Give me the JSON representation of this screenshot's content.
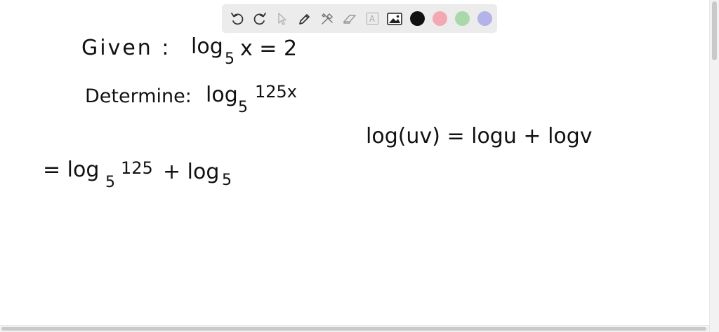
{
  "toolbar": {
    "tools": [
      {
        "name": "undo-icon"
      },
      {
        "name": "redo-icon"
      },
      {
        "name": "select-arrow-icon"
      },
      {
        "name": "pen-icon"
      },
      {
        "name": "tools-icon"
      },
      {
        "name": "eraser-icon"
      },
      {
        "name": "text-box-icon"
      },
      {
        "name": "image-icon"
      }
    ],
    "colors": {
      "black": "#111111",
      "pink": "#f2a9b3",
      "green": "#a9d8a9",
      "lavender": "#b3b3ea"
    },
    "text_tool_label": "A"
  },
  "board": {
    "line1": {
      "given": "Given :",
      "log": "log",
      "sub": "5",
      "rest": "x = 2"
    },
    "line2": {
      "determine": "Determine:",
      "log": "log",
      "sub": "5",
      "sup": "125x"
    },
    "rule": {
      "text": "log(uv) = logu + logv"
    },
    "line3": {
      "eq": "= log",
      "sub1": "5",
      "sup1": "125",
      "plus": "+ log",
      "sub2": "5"
    }
  }
}
